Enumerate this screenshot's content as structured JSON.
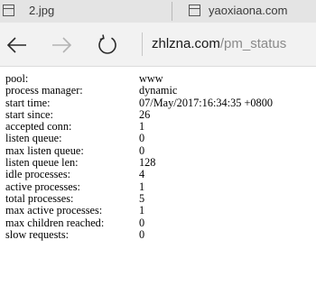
{
  "tabs": [
    {
      "label": "2.jpg",
      "icon": "page-icon"
    },
    {
      "label": "yaoxiaona.com",
      "icon": "page-icon"
    }
  ],
  "nav": {
    "back_icon": "back-arrow-icon",
    "forward_icon": "forward-arrow-icon",
    "refresh_icon": "refresh-icon"
  },
  "address": {
    "host": "zhlzna.com",
    "path": "/pm_status"
  },
  "status": [
    {
      "key": "pool:",
      "value": "www"
    },
    {
      "key": "process manager:",
      "value": "dynamic"
    },
    {
      "key": "start time:",
      "value": "07/May/2017:16:34:35 +0800"
    },
    {
      "key": "start since:",
      "value": "26"
    },
    {
      "key": "accepted conn:",
      "value": "1"
    },
    {
      "key": "listen queue:",
      "value": "0"
    },
    {
      "key": "max listen queue:",
      "value": "0"
    },
    {
      "key": "listen queue len:",
      "value": "128"
    },
    {
      "key": "idle processes:",
      "value": "4"
    },
    {
      "key": "active processes:",
      "value": "1"
    },
    {
      "key": "total processes:",
      "value": "5"
    },
    {
      "key": "max active processes:",
      "value": "1"
    },
    {
      "key": "max children reached:",
      "value": "0"
    },
    {
      "key": "slow requests:",
      "value": "0"
    }
  ]
}
